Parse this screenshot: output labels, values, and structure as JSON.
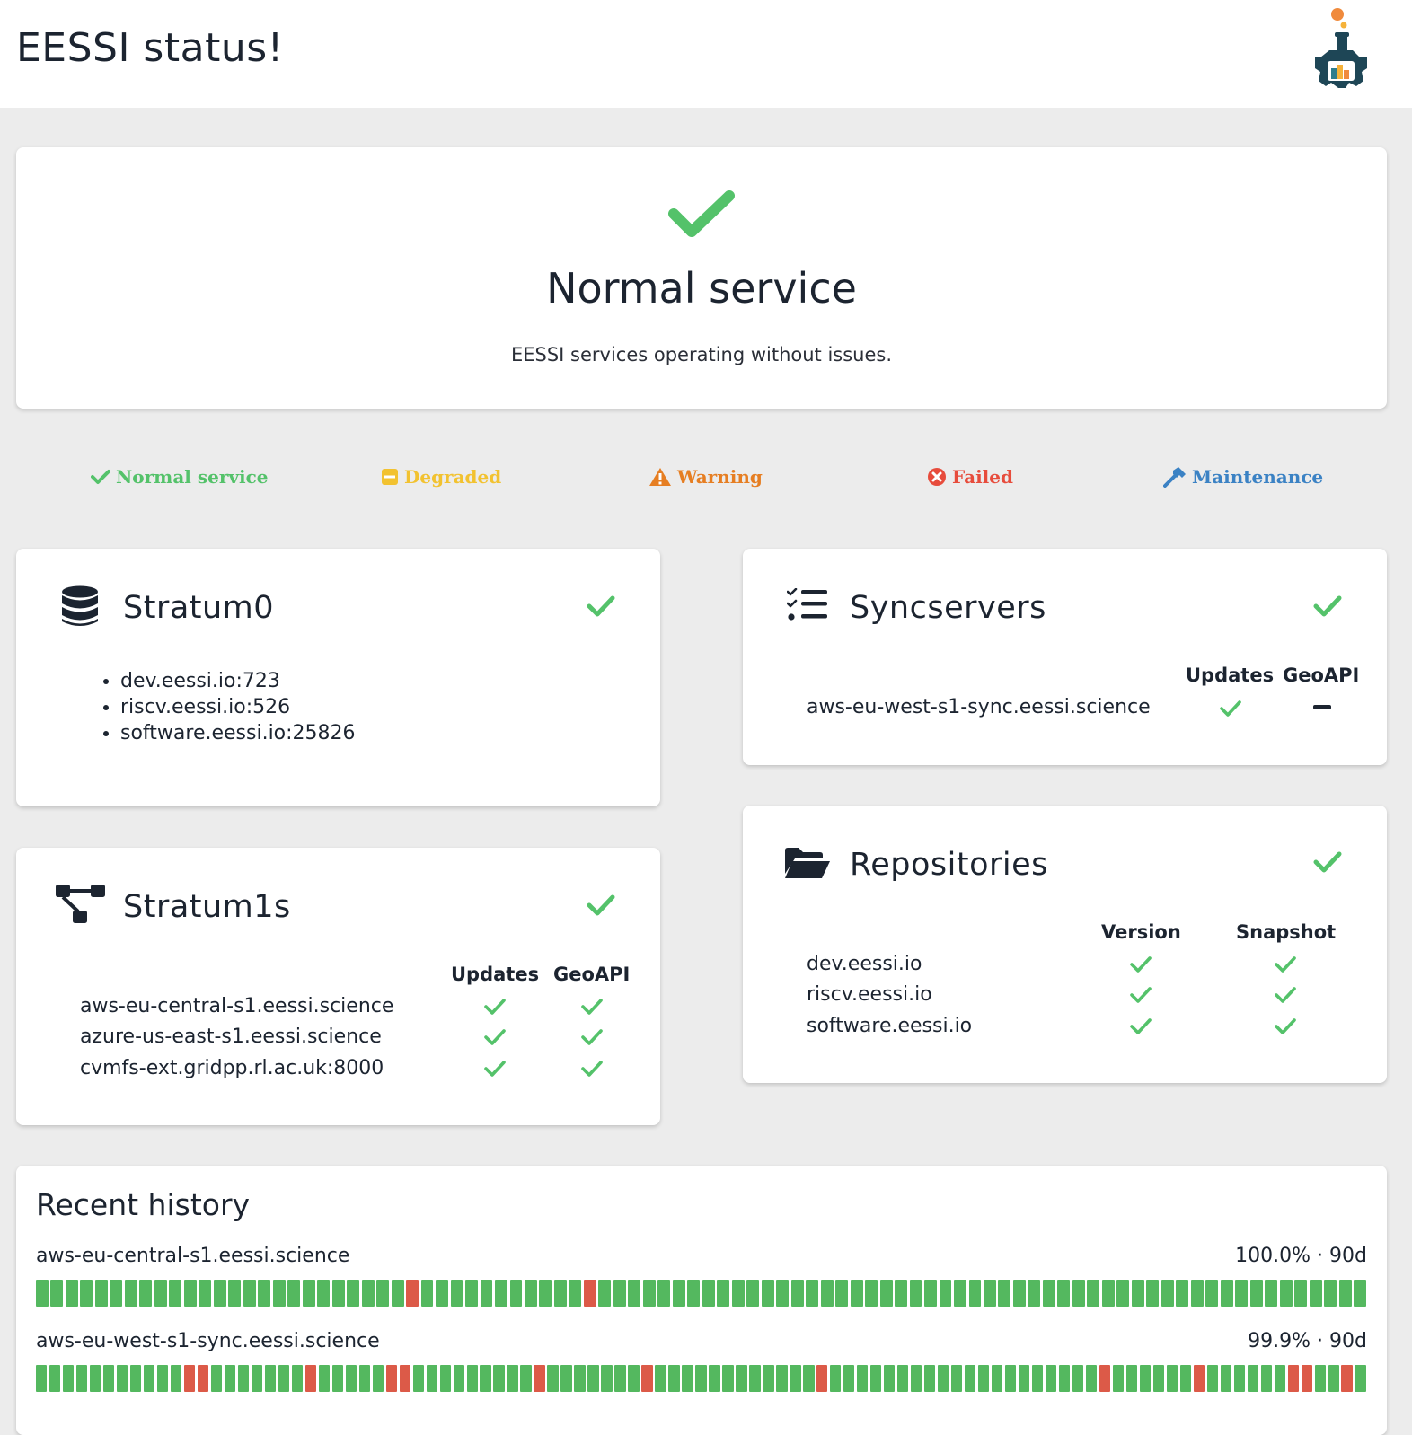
{
  "header": {
    "title": "EESSI status!"
  },
  "hero": {
    "title": "Normal service",
    "subtitle": "EESSI services operating without issues."
  },
  "legend": {
    "normal": "Normal service",
    "degraded": "Degraded",
    "warning": "Warning",
    "failed": "Failed",
    "maintenance": "Maintenance"
  },
  "colors": {
    "ok": "#54c26a",
    "degraded": "#f2c230",
    "warning": "#e67e22",
    "failed": "#e74c3c",
    "maintenance": "#3b82c4"
  },
  "stratum0": {
    "title": "Stratum0",
    "status_icon": "check-icon",
    "items": [
      "dev.eessi.io:723",
      "riscv.eessi.io:526",
      "software.eessi.io:25826"
    ]
  },
  "syncservers": {
    "title": "Syncservers",
    "status_icon": "check-icon",
    "columns": [
      "Updates",
      "GeoAPI"
    ],
    "rows": [
      {
        "name": "aws-eu-west-s1-sync.eessi.science",
        "updates": "check",
        "geoapi": "dash"
      }
    ]
  },
  "stratum1s": {
    "title": "Stratum1s",
    "status_icon": "check-icon",
    "columns": [
      "Updates",
      "GeoAPI"
    ],
    "rows": [
      {
        "name": "aws-eu-central-s1.eessi.science",
        "updates": "check",
        "geoapi": "check"
      },
      {
        "name": "azure-us-east-s1.eessi.science",
        "updates": "check",
        "geoapi": "check"
      },
      {
        "name": "cvmfs-ext.gridpp.rl.ac.uk:8000",
        "updates": "check",
        "geoapi": "check"
      }
    ]
  },
  "repositories": {
    "title": "Repositories",
    "status_icon": "check-icon",
    "columns": [
      "Version",
      "Snapshot"
    ],
    "rows": [
      {
        "name": "dev.eessi.io",
        "version": "check",
        "snapshot": "check"
      },
      {
        "name": "riscv.eessi.io",
        "version": "check",
        "snapshot": "check"
      },
      {
        "name": "software.eessi.io",
        "version": "check",
        "snapshot": "check"
      }
    ]
  },
  "history": {
    "title": "Recent history",
    "entries": [
      {
        "name": "aws-eu-central-s1.eessi.science",
        "uptime": "100.0% · 90d",
        "days": "111111111111111111111111101111111111101111111111111111111111111111111111111111111111111111"
      },
      {
        "name": "aws-eu-west-s1-sync.eessi.science",
        "uptime": "99.9% · 90d",
        "days": "111111111110011111110111110011111111101111111011111111111101111111111111111111101111110111111001101"
      }
    ]
  }
}
